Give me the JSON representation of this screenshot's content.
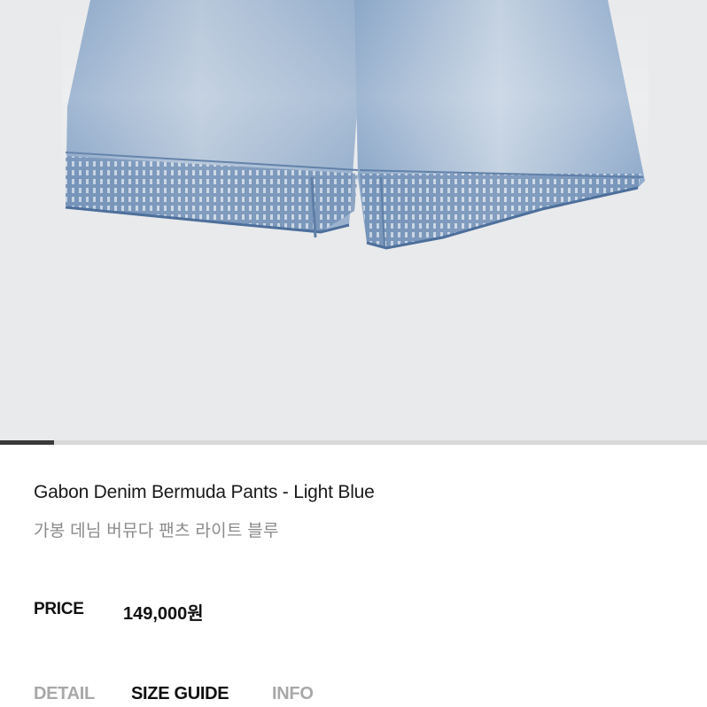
{
  "gallery": {
    "progress": 0.077,
    "background_color": "#e9eaec",
    "progress_color": "#3a3a3a"
  },
  "product": {
    "name_en": "Gabon Denim Bermuda Pants - Light Blue",
    "name_ko": "가봉 데님 버뮤다 팬츠 라이트 블루"
  },
  "price": {
    "label": "PRICE",
    "value": "149,000원"
  },
  "tabs": [
    {
      "label": "DETAIL",
      "active": false
    },
    {
      "label": "SIZE GUIDE",
      "active": true
    },
    {
      "label": "INFO",
      "active": false
    }
  ]
}
